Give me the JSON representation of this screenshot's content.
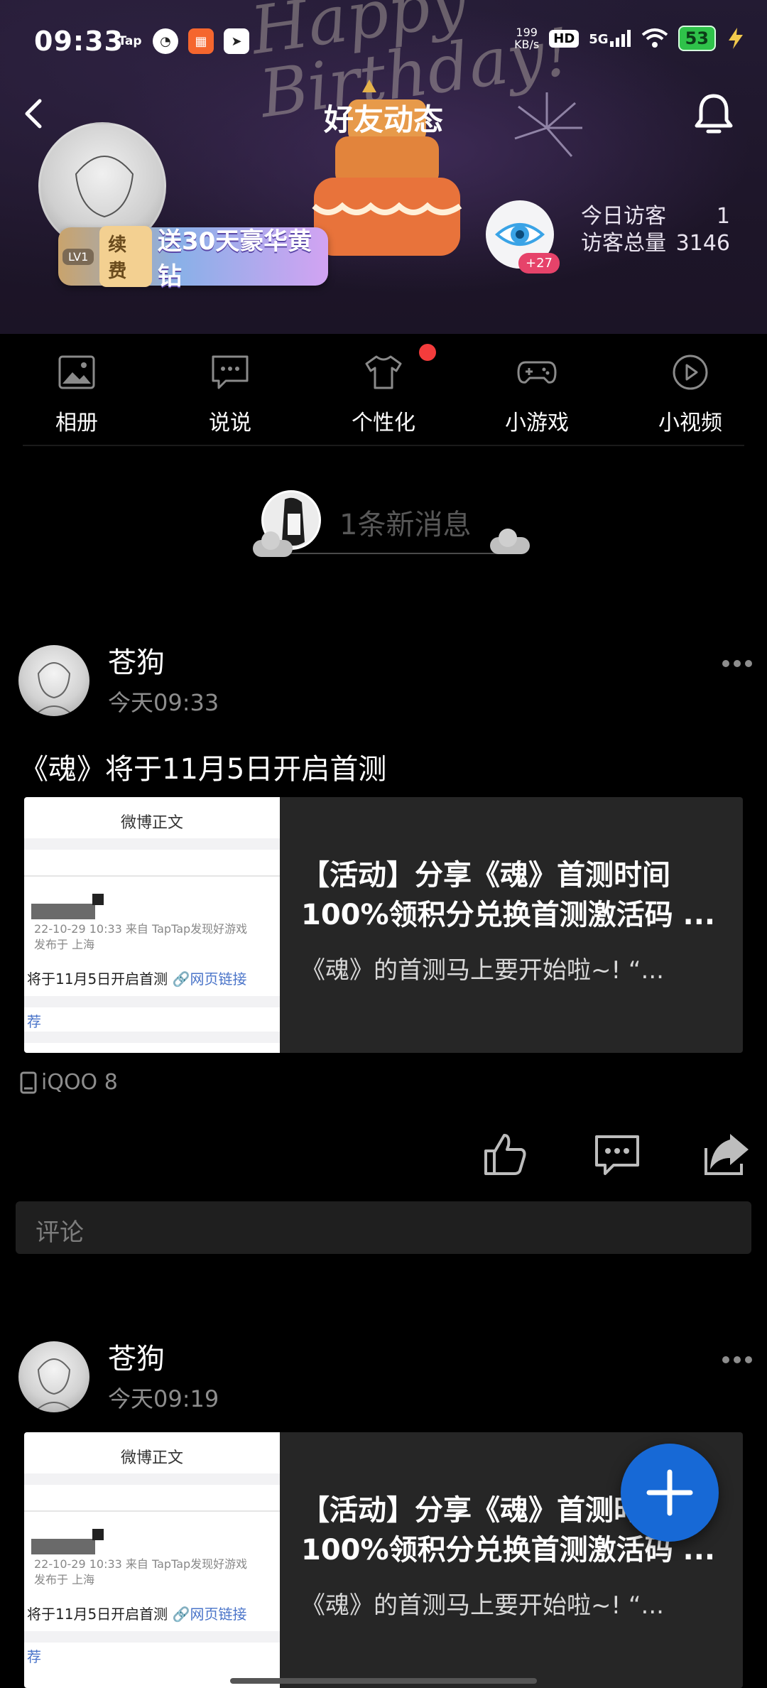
{
  "status_bar": {
    "time": "09:33",
    "net_speed_value": "199",
    "net_speed_unit": "KB/s",
    "hd": "HD",
    "signal": "5G",
    "battery": "53",
    "app_icons": [
      "tap-icon",
      "speedometer-icon",
      "app-grid-icon",
      "send-icon"
    ],
    "tap_label": "Tap"
  },
  "header": {
    "title": "好友动态",
    "banner_script": "Happy Birthday!",
    "vip_level": "LV1",
    "renew_label": "续费",
    "vip_promo": "送30天豪华黄钻",
    "visitor_badge": "+27",
    "today_visitors_label": "今日访客",
    "today_visitors_value": "1",
    "total_visitors_label": "访客总量",
    "total_visitors_value": "3146"
  },
  "quick_nav": [
    {
      "label": "相册",
      "icon": "album-icon"
    },
    {
      "label": "说说",
      "icon": "chat-bubble-icon"
    },
    {
      "label": "个性化",
      "icon": "tshirt-icon"
    },
    {
      "label": "小游戏",
      "icon": "gamepad-icon"
    },
    {
      "label": "小视频",
      "icon": "play-icon"
    }
  ],
  "new_messages": {
    "text": "1条新消息"
  },
  "posts": [
    {
      "author": "苍狗",
      "time": "今天09:33",
      "text": "《魂》将于11月5日开启首测",
      "card": {
        "thumb_title": "微博正文",
        "thumb_meta_1": "22-10-29 10:33  来自 TapTap发现好游戏",
        "thumb_meta_2": "发布于 上海",
        "thumb_body": "将于11月5日开启首测",
        "thumb_link": "网页链接",
        "thumb_more": "荐",
        "title": "【活动】分享《魂》首测时间100%领积分兑换首测激活码 ...",
        "desc": "《魂》的首测马上要开始啦~!  “..."
      },
      "device": "iQOO 8",
      "comment_placeholder": "评论"
    },
    {
      "author": "苍狗",
      "time": "今天09:19",
      "card": {
        "thumb_title": "微博正文",
        "thumb_meta_1": "22-10-29 10:33  来自 TapTap发现好游戏",
        "thumb_meta_2": "发布于 上海",
        "thumb_body": "将于11月5日开启首测",
        "thumb_link": "网页链接",
        "thumb_more": "荐",
        "title": "【活动】分享《魂》首测时间100%领积分兑换首测激活码 ...",
        "desc": "《魂》的首测马上要开始啦~!  “..."
      }
    }
  ],
  "colors": {
    "fab": "#1769d6",
    "badge_red": "#f43c3c",
    "battery_green": "#2fc24a"
  }
}
